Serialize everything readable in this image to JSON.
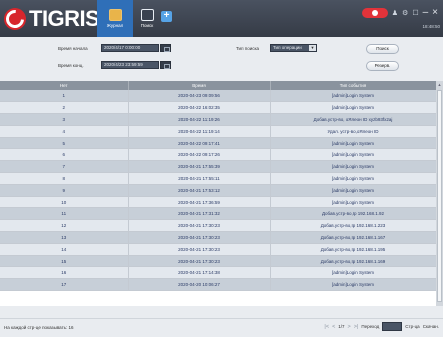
{
  "app": {
    "logo_text": "TIGRIS"
  },
  "nav": {
    "tabs": [
      {
        "label": "Журнал"
      },
      {
        "label": "Поиск"
      }
    ],
    "add_label": "+"
  },
  "titlebar": {
    "clock": "18:48:50"
  },
  "filters": {
    "start_label": "Время начала",
    "start_value": "2020/4/17 0:00:00",
    "end_label": "Время конц.",
    "end_value": "2020/4/23 23:59:59",
    "type_label": "Тип поиска",
    "type_value": "Тип операции",
    "search_btn": "Поиск",
    "backup_btn": "Резерв."
  },
  "table": {
    "headers": [
      "Нет",
      "Время",
      "Тип события"
    ],
    "rows": [
      [
        "1",
        "2020-04-23 09:09:56",
        "[admin]Login System"
      ],
      [
        "2",
        "2020-04-22 16:02:35",
        "[admin]Login System"
      ],
      [
        "3",
        "2020-04-22 11:19:26",
        "Добав.устр-во, оЯлеон ID xyzb93fx2aj"
      ],
      [
        "4",
        "2020-04-22 11:19:14",
        "Удал. устр-во,оЯлеон ID"
      ],
      [
        "5",
        "2020-04-22 09:17:41",
        "[admin]Login System"
      ],
      [
        "6",
        "2020-04-22 09:17:26",
        "[admin]Login System"
      ],
      [
        "7",
        "2020-04-21 17:55:39",
        "[admin]Login System"
      ],
      [
        "8",
        "2020-04-21 17:55:11",
        "[admin]Login System"
      ],
      [
        "9",
        "2020-04-21 17:53:12",
        "[admin]Login System"
      ],
      [
        "10",
        "2020-04-21 17:36:59",
        "[admin]Login System"
      ],
      [
        "11",
        "2020-04-21 17:31:32",
        "Добав.устр-во,Ip 192.168.1.92"
      ],
      [
        "12",
        "2020-04-21 17:30:23",
        "Добав.устр-во,Ip 192.168.1.223"
      ],
      [
        "13",
        "2020-04-21 17:30:23",
        "Добав.устр-во,Ip 192.168.1.167"
      ],
      [
        "14",
        "2020-04-21 17:30:23",
        "Добав.устр-во,Ip 192.168.1.195"
      ],
      [
        "15",
        "2020-04-21 17:30:23",
        "Добав.устр-во,Ip 192.168.1.169"
      ],
      [
        "16",
        "2020-04-21 17:14:38",
        "[admin]Login System"
      ],
      [
        "17",
        "2020-04-20 10:06:27",
        "[admin]Login System"
      ]
    ]
  },
  "footer": {
    "per_page_label": "На каждой стр-це показывать: 16",
    "page_indicator": "1/7",
    "goto_label": "Переход",
    "page_unit": "Стр-ца",
    "download_label": "Скачан."
  }
}
